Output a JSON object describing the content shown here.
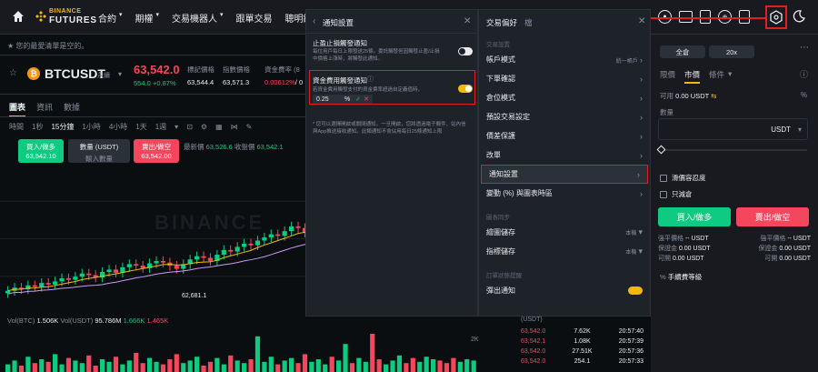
{
  "topbar": {
    "brand_top": "BINANCE",
    "brand_bottom": "FUTURES",
    "nav": [
      "合約",
      "期權",
      "交易機器人",
      "跟單交易",
      "聰明鏈"
    ]
  },
  "notice": "您的最愛清單是空的。",
  "symbol": {
    "name": "BTCUSDT",
    "type": "永續",
    "price": "63,542.0",
    "change_abs": "554.0",
    "change_pct": "+0.87%",
    "mark_label": "標記價格",
    "mark_value": "63,544.4",
    "index_label": "指數價格",
    "index_value": "63,571.3",
    "funding_label": "資金費率 (8",
    "funding_value": "0.00612%",
    "funding_time": "/ 0"
  },
  "tabs": [
    "圖表",
    "資訊",
    "數據"
  ],
  "timeframes": [
    "時間",
    "1秒",
    "15分鐘",
    "1小時",
    "4小時",
    "1天",
    "1週"
  ],
  "quick_trade": {
    "buy_label": "買入/做多",
    "buy_price": "63,542.10",
    "qty_label": "數量 (USDT)",
    "qty_placeholder": "輸入數量",
    "sell_label": "賣出/做空",
    "sell_price": "63,542.00"
  },
  "price_row": {
    "latest_label": "最新價",
    "latest_value": "63,526.6",
    "close_label": "收盤價",
    "close_value": "63,542.1"
  },
  "chart": {
    "low_label": "62,681.1",
    "watermark": "BINANCE",
    "vol_label": "Vol(BTC)",
    "vol_btc": "1.506K",
    "vol_usdt_label": "Vol(USDT)",
    "vol_usdt": "95.786M",
    "vol_ma1": "1.666K",
    "vol_ma2": "1.465K",
    "axis_2k": "2K"
  },
  "chart_data": {
    "type": "candlestick",
    "series": [
      {
        "name": "price",
        "values": [
          28,
          32,
          30,
          35,
          33,
          38,
          36,
          40,
          44,
          42,
          46,
          50,
          48,
          45,
          52,
          55,
          51,
          58,
          62,
          60,
          57,
          63,
          66,
          64,
          60,
          56,
          62,
          68,
          72,
          70,
          66,
          74,
          80,
          78,
          84,
          88,
          86,
          92,
          96,
          100,
          98,
          104,
          110,
          108,
          102,
          106,
          112,
          118,
          116,
          122,
          126,
          124,
          130,
          134,
          128,
          120,
          126,
          132,
          138,
          136,
          132,
          140,
          146,
          150,
          148,
          142,
          138,
          144,
          150,
          156
        ]
      },
      {
        "name": "volume",
        "values": [
          6,
          9,
          5,
          12,
          7,
          10,
          8,
          14,
          6,
          11,
          9,
          7,
          13,
          5,
          10,
          8,
          12,
          6,
          9,
          15,
          7,
          11,
          8,
          6,
          10,
          14,
          7,
          9,
          12,
          5,
          8,
          11,
          6,
          13,
          9,
          7,
          10,
          28,
          8,
          12,
          6,
          9,
          11,
          7,
          14,
          8,
          10,
          6,
          12,
          9,
          22,
          7,
          11,
          8,
          30,
          10,
          6,
          9,
          13,
          7,
          11,
          8,
          12,
          10,
          9,
          7,
          11,
          8,
          10,
          9
        ]
      }
    ]
  },
  "notif_panel": {
    "title": "通知設置",
    "sltp_title": "止盈止損觸發通知",
    "sltp_desc1": "每位用戶每日上限發送25條。委託觸發但因觸發止盈/止損",
    "sltp_desc2": "中價格上漲時，將觸發此通知。",
    "funding_title": "資金費用觸發通知",
    "funding_desc": "若資金費用觸發支付的資金費率超過自定義值時，",
    "funding_value": "0.25",
    "funding_unit": "%",
    "footer1": "* 您可以選擇開啟或關閉通知，一旦開啟，您將透過電子郵件、站內信",
    "footer2": "與App推送接收通知。此類通知不會佔用每日25條通知上限"
  },
  "pref_panel": {
    "tab_active": "交易偏好",
    "tab_other": "檔",
    "section1": "交易設置",
    "item_mode": "帳戶模式",
    "item_mode_value": "統一帳戶",
    "item_order_confirm": "下單確認",
    "item_position_mode": "倉位模式",
    "item_preset": "預設交易設定",
    "item_protect": "價差保護",
    "item_slippage": "改單",
    "item_notif": "通知設置",
    "item_chart": "變動 (%) 與圖表時區",
    "section2": "圖表同步",
    "item_draw": "繪圖儲存",
    "item_draw_value": "本機",
    "item_indicator": "指標儲存",
    "item_indicator_value": "本機",
    "section3": "訂單狀態提醒",
    "item_popup": "彈出通知"
  },
  "order_panel": {
    "margin_mode": "全倉",
    "leverage": "20x",
    "tab_limit": "限價",
    "tab_market": "市價",
    "tab_conditional": "條件",
    "available_label": "可用",
    "available_value": "0.00 USDT",
    "qty_label": "數量",
    "qty_unit": "USDT",
    "slippage_label": "滑價容忍度",
    "reduce_only_label": "只減倉",
    "buy_button": "買入/做多",
    "sell_button": "賣出/做空",
    "liq_buy_label": "強平價格",
    "liq_buy_value": "-- USDT",
    "margin_buy_label": "保證金",
    "margin_buy_value": "0.00 USDT",
    "max_buy_label": "可開",
    "max_buy_value": "0.00 USDT",
    "liq_sell_label": "強平價格",
    "liq_sell_value": "-- USDT",
    "margin_sell_label": "保證金",
    "margin_sell_value": "0.00 USDT",
    "max_sell_label": "可開",
    "max_sell_value": "0.00 USDT",
    "fee_label": "手續費等級"
  },
  "trades": {
    "header": "(USDT)",
    "rows": [
      {
        "price": "63,542.0",
        "qty": "7.62K",
        "time": "20:57:40"
      },
      {
        "price": "63,542.1",
        "qty": "1.08K",
        "time": "20:57:39"
      },
      {
        "price": "63,542.0",
        "qty": "27.51K",
        "time": "20:57:36"
      },
      {
        "price": "63,542.0",
        "qty": "254.1",
        "time": "20:57:33"
      }
    ]
  },
  "colors": {
    "up": "#0ecb81",
    "down": "#f6465d",
    "accent": "#f0b90b",
    "highlight": "#e02020"
  }
}
